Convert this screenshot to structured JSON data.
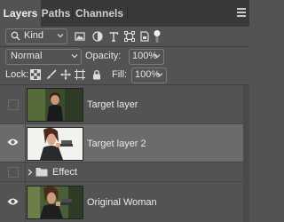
{
  "tabs": [
    {
      "label": "Layers",
      "active": true
    },
    {
      "label": "Paths",
      "active": false
    },
    {
      "label": "Channels",
      "active": false
    }
  ],
  "filter": {
    "kind_label": "Kind"
  },
  "blend": {
    "mode": "Normal",
    "opacity_label": "Opacity:",
    "opacity_value": "100%"
  },
  "lock": {
    "label": "Lock:",
    "fill_label": "Fill:",
    "fill_value": "100%"
  },
  "layers": [
    {
      "name": "Target layer",
      "visible": false,
      "selected": false,
      "type": "image"
    },
    {
      "name": "Target layer 2",
      "visible": true,
      "selected": true,
      "type": "image"
    },
    {
      "name": "Effect",
      "visible": false,
      "selected": false,
      "type": "group",
      "collapsed": true
    },
    {
      "name": "Original Woman",
      "visible": true,
      "selected": false,
      "type": "image"
    }
  ],
  "colors": {
    "panel_bg": "#535353",
    "tab_bar_bg": "#393939",
    "selected_row": "#6b6b6b"
  }
}
